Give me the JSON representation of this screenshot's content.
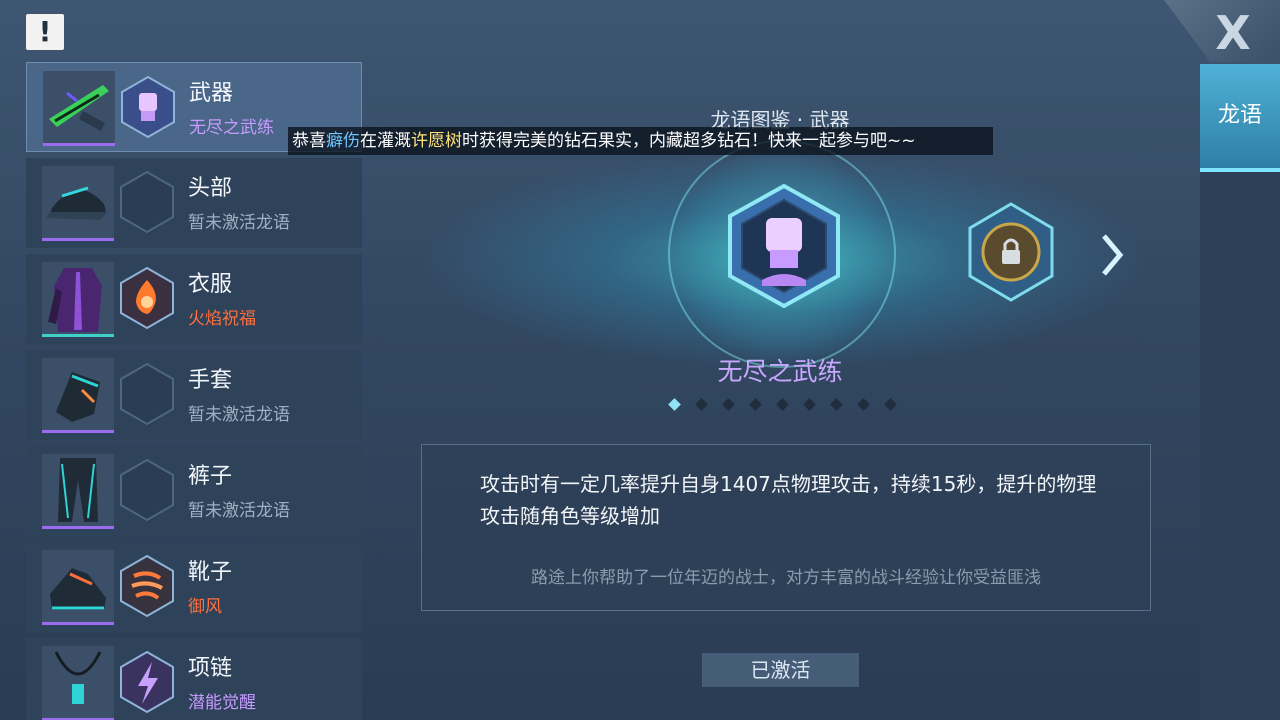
{
  "alert_label": "!",
  "close_label": "X",
  "right_tab": {
    "label": "龙语"
  },
  "equip_list": [
    {
      "name": "武器",
      "status": "无尽之武练",
      "icon": "fist-hex-icon"
    },
    {
      "name": "头部",
      "status": "暂未激活龙语",
      "icon": "empty-hex-slot"
    },
    {
      "name": "衣服",
      "status": "火焰祝福",
      "icon": "flame-hex-icon"
    },
    {
      "name": "手套",
      "status": "暂未激活龙语",
      "icon": "empty-hex-slot"
    },
    {
      "name": "裤子",
      "status": "暂未激活龙语",
      "icon": "empty-hex-slot"
    },
    {
      "name": "靴子",
      "status": "御风",
      "icon": "wind-hex-icon"
    },
    {
      "name": "项链",
      "status": "潜能觉醒",
      "icon": "lightning-hex-icon"
    }
  ],
  "center": {
    "title": "龙语图鉴 · 武器",
    "skill_name": "无尽之武练",
    "page_count": 9,
    "active_page": 1,
    "description": "攻击时有一定几率提升自身1407点物理攻击，持续15秒，提升的物理攻击随角色等级增加",
    "flavor": "路途上你帮助了一位年迈的战士，对方丰富的战斗经验让你受益匪浅",
    "status_button": "已激活"
  },
  "broadcast": {
    "prefix": "恭喜",
    "player": "癖伤",
    "mid": "在灌溉",
    "target": "许愿树",
    "suffix": "时获得完美的钻石果实，内藏超多钻石！快来一起参与吧~~"
  },
  "colors": {
    "accent_cyan": "#4fb1d6",
    "rare_purple": "#c79bff",
    "fire_orange": "#ff6f3c"
  }
}
